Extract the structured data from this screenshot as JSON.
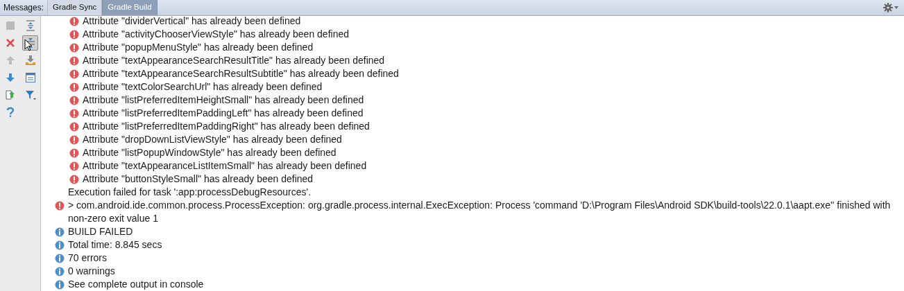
{
  "header": {
    "label": "Messages:",
    "tabs": [
      {
        "label": "Gradle Sync",
        "selected": false
      },
      {
        "label": "Gradle Build",
        "selected": true
      }
    ]
  },
  "toolbar": [
    {
      "kind": "stop",
      "disabled": true,
      "selected": false
    },
    {
      "kind": "expand",
      "disabled": false,
      "selected": false
    },
    {
      "kind": "close",
      "disabled": false,
      "selected": false
    },
    {
      "kind": "collapse",
      "disabled": false,
      "selected": true
    },
    {
      "kind": "up",
      "disabled": true,
      "selected": false
    },
    {
      "kind": "export",
      "disabled": false,
      "selected": false
    },
    {
      "kind": "down",
      "disabled": false,
      "selected": false
    },
    {
      "kind": "preview",
      "disabled": false,
      "selected": false
    },
    {
      "kind": "open",
      "disabled": false,
      "selected": false
    },
    {
      "kind": "filter",
      "disabled": false,
      "selected": false
    },
    {
      "kind": "help",
      "disabled": false,
      "selected": false
    }
  ],
  "messages": [
    {
      "kind": "group",
      "children": [
        {
          "kind": "error",
          "text": "Attribute \"dividerVertical\" has already been defined"
        },
        {
          "kind": "error",
          "text": "Attribute \"activityChooserViewStyle\" has already been defined"
        },
        {
          "kind": "error",
          "text": "Attribute \"popupMenuStyle\" has already been defined"
        },
        {
          "kind": "error",
          "text": "Attribute \"textAppearanceSearchResultTitle\" has already been defined"
        },
        {
          "kind": "error",
          "text": "Attribute \"textAppearanceSearchResultSubtitle\" has already been defined"
        },
        {
          "kind": "error",
          "text": "Attribute \"textColorSearchUrl\" has already been defined"
        },
        {
          "kind": "error",
          "text": "Attribute \"listPreferredItemHeightSmall\" has already been defined"
        },
        {
          "kind": "error",
          "text": "Attribute \"listPreferredItemPaddingLeft\" has already been defined"
        },
        {
          "kind": "error",
          "text": "Attribute \"listPreferredItemPaddingRight\" has already been defined"
        },
        {
          "kind": "error",
          "text": "Attribute \"dropDownListViewStyle\" has already been defined"
        },
        {
          "kind": "error",
          "text": "Attribute \"listPopupWindowStyle\" has already been defined"
        },
        {
          "kind": "error",
          "text": "Attribute \"textAppearanceListItemSmall\" has already been defined"
        },
        {
          "kind": "error",
          "text": "Attribute \"buttonStyleSmall\" has already been defined"
        }
      ]
    },
    {
      "kind": "text",
      "text": "Execution failed for task ':app:processDebugResources'."
    },
    {
      "kind": "error",
      "text": "> com.android.ide.common.process.ProcessException: org.gradle.process.internal.ExecException: Process 'command 'D:\\Program Files\\Android SDK\\build-tools\\22.0.1\\aapt.exe'' finished with non-zero exit value 1"
    },
    {
      "kind": "info",
      "text": "BUILD FAILED"
    },
    {
      "kind": "info",
      "text": "Total time: 8.845 secs"
    },
    {
      "kind": "info",
      "text": "70 errors"
    },
    {
      "kind": "info",
      "text": "0 warnings"
    },
    {
      "kind": "info",
      "text": "See complete output in console"
    }
  ]
}
